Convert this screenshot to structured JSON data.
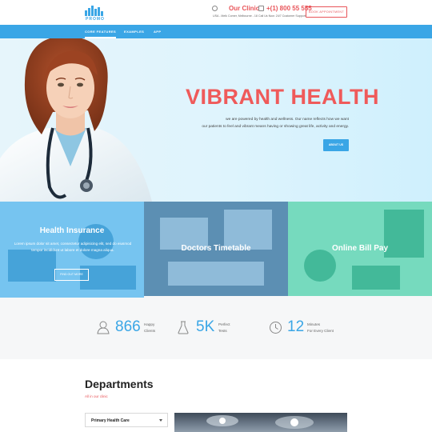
{
  "header": {
    "logo_text": "PROMO",
    "clinic": {
      "title": "Our Clinic",
      "address": "USA - Melk Corner, Melbourne - 18",
      "icon": "globe-icon"
    },
    "phone": {
      "number": "+(1) 800 55 555",
      "note": "Call Us Now: 24/7 Customer Support",
      "icon": "phone-icon"
    },
    "appointment_button": "BOOK APPOINTMENT"
  },
  "nav": {
    "items": [
      {
        "label": "CORE FEATURES",
        "active": true
      },
      {
        "label": "EXAMPLES",
        "active": false
      },
      {
        "label": "APP",
        "active": false
      }
    ]
  },
  "hero": {
    "title": "VIBRANT HEALTH",
    "subtitle_line1": "we are powered by health and wellness. Our name reflects how we want",
    "subtitle_line2": "our patients to feel and vibrant means having or showing great life, activity and energy.",
    "button": "ABOUT US"
  },
  "panels": [
    {
      "title": "Health Insurance",
      "text": "Lorem ipsum dolor sit amet, consectetur adipisicing elit, sed do eiusmod tempor incididunt ut labore et dolore magna aliqua.",
      "button": "FIND OUT MORE",
      "color": "#4fb4ec"
    },
    {
      "title": "Doctors Timetable",
      "color": "#6fa8cf"
    },
    {
      "title": "Online Bill Pay",
      "color": "#4fd0ac"
    }
  ],
  "stats": [
    {
      "icon": "user-icon",
      "number": "866",
      "label_line1": "Happy",
      "label_line2": "Clients"
    },
    {
      "icon": "flask-icon",
      "number": "5K",
      "label_line1": "Perfect",
      "label_line2": "Tests"
    },
    {
      "icon": "clock-icon",
      "number": "12",
      "label_line1": "Minutes",
      "label_line2": "For Every Client"
    }
  ],
  "departments": {
    "title": "Departments",
    "subtitle": "All in our clinic",
    "selected": "Primary Health Care"
  },
  "colors": {
    "accent_blue": "#3aa6e6",
    "accent_red": "#ef5a5a"
  }
}
